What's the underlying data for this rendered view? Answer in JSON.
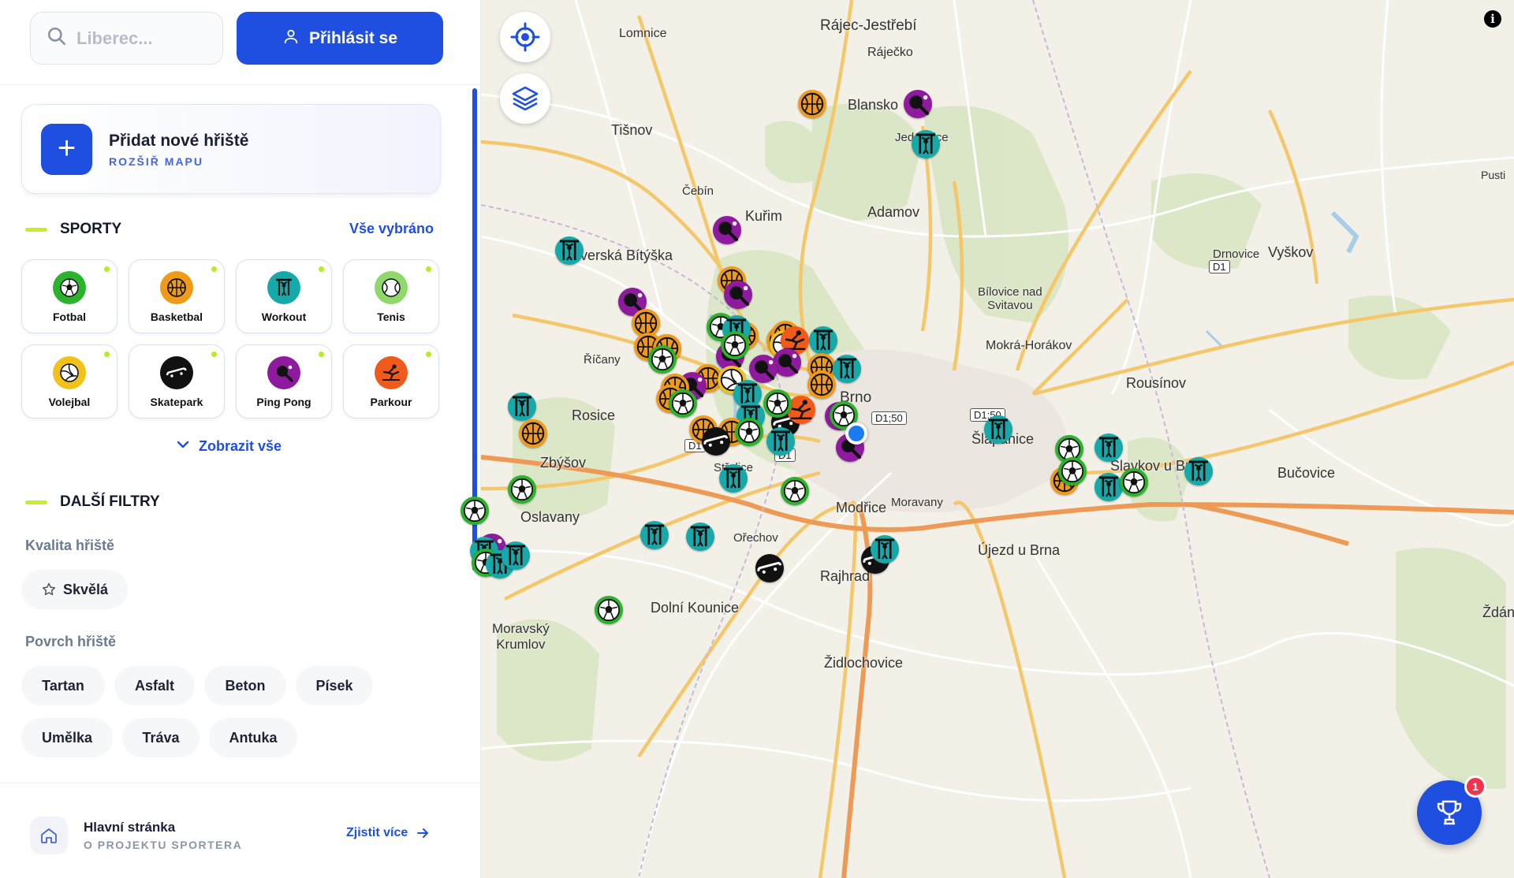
{
  "search": {
    "placeholder": "Liberec..."
  },
  "header": {
    "login_label": "Přihlásit se"
  },
  "add_card": {
    "title": "Přidat nové hřiště",
    "subtitle": "ROZŠIŘ MAPU"
  },
  "sports": {
    "heading": "SPORTY",
    "select_all": "Vše vybráno",
    "items": [
      {
        "key": "fotbal",
        "label": "Fotbal",
        "icon": "soccer-ball-icon",
        "color": "#2cb32c"
      },
      {
        "key": "basketbal",
        "label": "Basketbal",
        "icon": "basketball-icon",
        "color": "#f09a1a"
      },
      {
        "key": "workout",
        "label": "Workout",
        "icon": "workout-icon",
        "color": "#17a9a9"
      },
      {
        "key": "tenis",
        "label": "Tenis",
        "icon": "tennis-ball-icon",
        "color": "#8fd86a"
      },
      {
        "key": "volejbal",
        "label": "Volejbal",
        "icon": "volleyball-icon",
        "color": "#f2c21b"
      },
      {
        "key": "skatepark",
        "label": "Skatepark",
        "icon": "skateboard-icon",
        "color": "#111111"
      },
      {
        "key": "pingpong",
        "label": "Ping Pong",
        "icon": "ping-pong-icon",
        "color": "#8e1a9e"
      },
      {
        "key": "parkour",
        "label": "Parkour",
        "icon": "parkour-icon",
        "color": "#f05a1a"
      }
    ],
    "show_all": "Zobrazit vše"
  },
  "filters": {
    "heading": "DALŠÍ FILTRY",
    "quality_label": "Kvalita hřiště",
    "quality_options": [
      "Skvělá"
    ],
    "surface_label": "Povrch hřiště",
    "surface_options": [
      "Tartan",
      "Asfalt",
      "Beton",
      "Písek",
      "Umělka",
      "Tráva",
      "Antuka"
    ]
  },
  "footer": {
    "title": "Hlavní stránka",
    "subtitle": "O PROJEKTU SPORTERA",
    "link": "Zjistit více"
  },
  "map": {
    "places": [
      "Lomnice",
      "Rájec-Jestřebí",
      "Ráječko",
      "Blansko",
      "Jedovnice",
      "Tišnov",
      "Čebín",
      "Kuřim",
      "Adamov",
      "Pusti",
      "Drnovice",
      "Vyškov",
      "Veverská Bítýška",
      "Bílovice nad Svitavou",
      "Mokrá-Horákov",
      "Říčany",
      "Rousínov",
      "Brno",
      "Šlapanice",
      "Slavkov u Brna",
      "Bučovice",
      "Rosice",
      "Zbýšov",
      "Střelice",
      "Modřice",
      "Moravany",
      "Oslavany",
      "Ořechov",
      "Újezd u Brna",
      "Rajhrad",
      "Dolní Kounice",
      "Moravský Krumlov",
      "Židlochovice",
      "Ždán"
    ],
    "road_labels": [
      "D1",
      "D1;50",
      "D1;50",
      "D1",
      "D1"
    ],
    "info_label": "i",
    "trophy_badge": "1"
  }
}
